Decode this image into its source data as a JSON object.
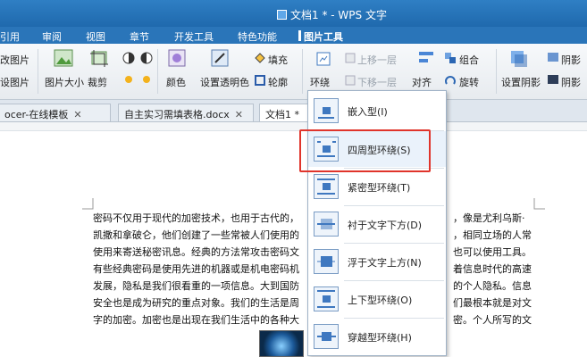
{
  "window": {
    "title": "文档1 * - WPS 文字"
  },
  "menubar": {
    "items": [
      "引用",
      "审阅",
      "视图",
      "章节",
      "开发工具",
      "特色功能",
      "图片工具"
    ],
    "active": "图片工具"
  },
  "ribbon": {
    "change_picture_1": "改图片",
    "change_picture_2": "设图片",
    "picture_size": "图片大小",
    "crop": "裁剪",
    "color": "颜色",
    "set_transparent": "设置透明色",
    "fill": "填充",
    "outline": "轮廓",
    "wrap": "环绕",
    "bring_forward": "上移一层",
    "send_backward": "下移一层",
    "align": "对齐",
    "group": "组合",
    "rotate": "旋转",
    "set_shadow": "设置阴影",
    "shadow_1": "阴影",
    "shadow_2": "阴影"
  },
  "tabs": [
    {
      "label": "ocer-在线模板"
    },
    {
      "label": "自主实习需填表格.docx"
    },
    {
      "label": "文档1 *"
    }
  ],
  "document": {
    "lines": [
      "密码不仅用于现代的加密技术，也用于古代的，",
      "凯撒和拿破仑，他们创建了一些常被人们使用的",
      "使用来寄送秘密讯息。经典的方法常攻击密码文",
      "有些经典密码是使用先进的机器或是机电密码机",
      "发展，隐私是我们很看重的一项信息。大到国防",
      "安全也是成为研究的重点对象。我们的生活是周",
      "字的加密。加密也是出现在我们生活中的各种大"
    ],
    "lines_right": [
      "，像是尤利乌斯·",
      "，相同立场的人常",
      "也可以使用工具。",
      "着信息时代的高速",
      "的个人隐私。信息",
      "们最根本就是对文",
      "密。个人所写的文"
    ]
  },
  "wrap_menu": {
    "items": [
      {
        "label": "嵌入型(I)"
      },
      {
        "label": "四周型环绕(S)"
      },
      {
        "label": "紧密型环绕(T)"
      },
      {
        "label": "衬于文字下方(D)"
      },
      {
        "label": "浮于文字上方(N)"
      },
      {
        "label": "上下型环绕(O)"
      },
      {
        "label": "穿越型环绕(H)"
      }
    ],
    "highlighted": "四周型环绕(S)"
  },
  "colors": {
    "accent": "#2a75b9",
    "highlight": "#e0342b"
  }
}
